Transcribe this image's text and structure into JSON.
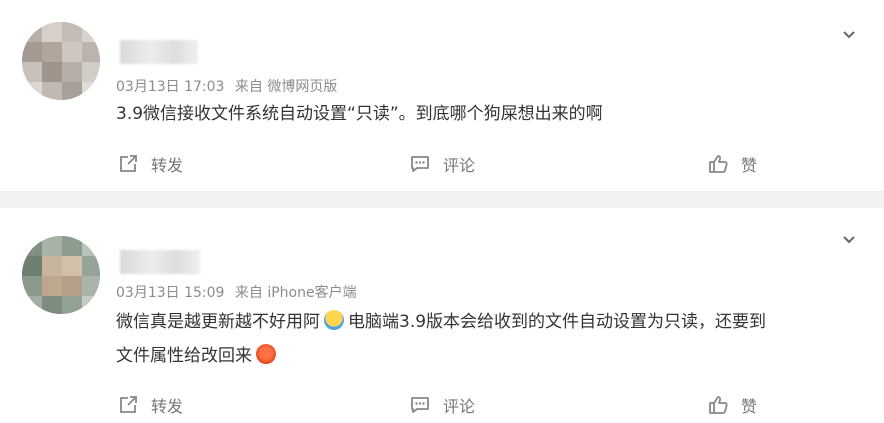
{
  "posts": [
    {
      "date": "03月13日 17:03",
      "source": "来自 微博网页版",
      "lines": [
        "3.9微信接收文件系统自动设置“只读”。到底哪个狗屎想出来的啊"
      ],
      "actions": {
        "repost": "转发",
        "comment": "评论",
        "like": "赞"
      }
    },
    {
      "date": "03月13日 15:09",
      "source": "来自 iPhone客户端",
      "line1_a": "微信真是越更新越不好用阿",
      "line1_b": "电脑端3.9版本会给收到的文件自动设置为只读，还要到",
      "line2": "文件属性给改回来",
      "actions": {
        "repost": "转发",
        "comment": "评论",
        "like": "赞"
      }
    }
  ],
  "icons": {
    "chevron": "chevron-down-icon",
    "repost": "share-icon",
    "comment": "comment-icon",
    "like": "thumbs-up-icon"
  }
}
